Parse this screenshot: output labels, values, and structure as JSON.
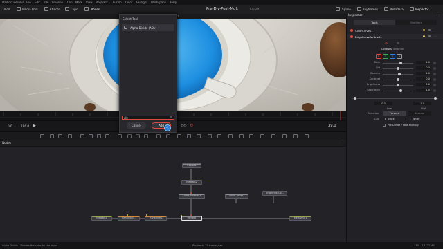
{
  "app": {
    "name": "DaVinci Resolve",
    "project_title": "Pre-Div-Post-Mult",
    "project_status": "Edited",
    "menu": [
      "File",
      "Edit",
      "Trim",
      "Timeline",
      "Clip",
      "Mark",
      "View",
      "Playback",
      "Fusion",
      "Color",
      "Fairlight",
      "Workspace",
      "Help"
    ]
  },
  "toolbar": {
    "zoom": "107%",
    "left_buttons": [
      "Media Pool",
      "Effects",
      "Clips",
      "Nodes"
    ],
    "right_buttons": [
      "Spline",
      "Keyframes",
      "Metadata",
      "Inspector"
    ]
  },
  "viewer": {
    "header_title": "Mediaout1",
    "start_frame": "0.0",
    "end_frame": "196.0",
    "current_frame": "39.0"
  },
  "select_tool": {
    "title": "Select Tool",
    "result": "Alpha Divide (ADv)",
    "search_value": "div",
    "cancel_label": "Cancel",
    "add_label": "Add"
  },
  "nodes_panel": {
    "title": "Nodes",
    "nodes": [
      {
        "id": "ellipse1",
        "label": "Ellipse1"
      },
      {
        "id": "mediain2",
        "label": "MediaIn2"
      },
      {
        "id": "colorcorrector1",
        "label": "ColorCorrector1"
      },
      {
        "id": "colorcurves1",
        "label": "ColorCurves1"
      },
      {
        "id": "brightnesscontrast1",
        "label": "BrightnessCo..."
      },
      {
        "id": "mediain1",
        "label": "MediaIn1"
      },
      {
        "id": "planartracker",
        "label": "PlanarTrac..."
      },
      {
        "id": "transform2",
        "label": "Transform2"
      },
      {
        "id": "merge2",
        "label": "Merge2"
      },
      {
        "id": "mediaout1",
        "label": "MediaOut1"
      }
    ]
  },
  "inspector": {
    "title": "Inspector",
    "tabs": [
      "Tools",
      "Modifiers"
    ],
    "tools": [
      {
        "name": "ColorCurves1"
      },
      {
        "name": "BrightnessContrast1"
      }
    ],
    "subtabs": [
      "Controls",
      "Settings"
    ],
    "channels": [
      "R",
      "G",
      "B",
      "A"
    ],
    "sliders": [
      {
        "label": "Gain",
        "value": "1.0",
        "fraction": 0.6
      },
      {
        "label": "Lift",
        "value": "0.0",
        "fraction": 0.5
      },
      {
        "label": "Gamma",
        "value": "1.0",
        "fraction": 0.55
      },
      {
        "label": "Contrast",
        "value": "0.0",
        "fraction": 0.5
      },
      {
        "label": "Brightness",
        "value": "0.0",
        "fraction": 0.5
      },
      {
        "label": "Saturation",
        "value": "1.0",
        "fraction": 0.6
      }
    ],
    "range": {
      "low": "0.0",
      "high": "1.0",
      "low_label": "Low",
      "high_label": "High"
    },
    "direction": {
      "label": "Direction",
      "options": [
        "Forward",
        "Reverse"
      ],
      "selected": "Forward"
    },
    "clip": {
      "label": "Clip",
      "options": [
        "Black",
        "White"
      ]
    },
    "pre_divide_label": "Pre-Divide / Post-Multiply"
  },
  "status_bar": {
    "left": "Alpha Divide - Divides the color by the alpha",
    "center": "Playback: 25 frames/sec",
    "right": "17% - 13127 MB"
  },
  "colors": {
    "accent": "#e0473c",
    "active_blue": "#2c7fd6",
    "background": "#1c1c1f"
  }
}
